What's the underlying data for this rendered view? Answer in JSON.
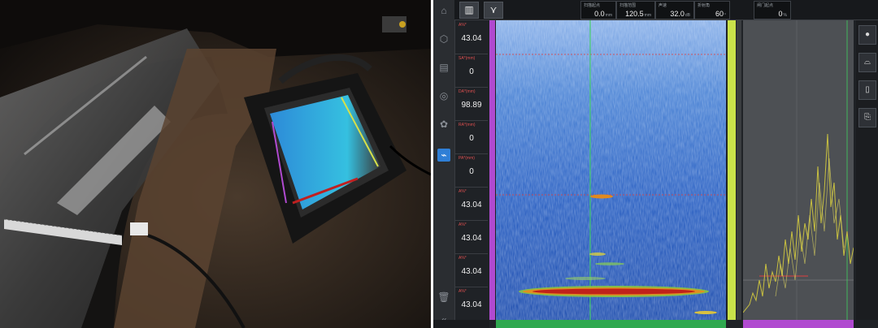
{
  "photo": {
    "description_icon": "ultrasonic-flaw-detector-photo"
  },
  "ui": {
    "toolbar": {
      "layout_icon": "layout-icon",
      "mode_icon": "wedge-icon",
      "readouts": [
        {
          "label": "扫描起点",
          "value": "0.0",
          "unit": "mm"
        },
        {
          "label": "扫描范围",
          "value": "120.5",
          "unit": "mm"
        },
        {
          "label": "声速",
          "value": "32.0",
          "unit": "dB"
        },
        {
          "label": "折射角",
          "value": "60",
          "unit": "°"
        },
        {
          "label": "闸门起点",
          "value": "0",
          "unit": "%"
        }
      ]
    },
    "params": [
      {
        "label": "A%*",
        "value": "43.04"
      },
      {
        "label": "SA*(mm)",
        "value": "0"
      },
      {
        "label": "DA*(mm)",
        "value": "98.89"
      },
      {
        "label": "RA*(mm)",
        "value": "0"
      },
      {
        "label": "PA*(mm)",
        "value": "0"
      },
      {
        "label": "A%*",
        "value": "43.04"
      },
      {
        "label": "A%*",
        "value": "43.04"
      },
      {
        "label": "A%*",
        "value": "43.04"
      },
      {
        "label": "A%*",
        "value": "43.04"
      }
    ],
    "colors": {
      "accent": "#2f7fd6",
      "gate_magenta": "#b04ad0",
      "gate_green": "#2fa84f",
      "gate_yellow": "#c9e24a",
      "bscan_base": "#2a5fc0",
      "indication_red": "#c0221a"
    },
    "sidebar_icons": [
      "circle-icon",
      "probe-icon",
      "save-icon",
      "report-icon"
    ],
    "left_icons": [
      "home-icon",
      "settings-icon",
      "calibrate-icon",
      "measure-icon",
      "tool-icon",
      "ascan-icon",
      "delete-icon",
      "collapse-icon"
    ]
  }
}
